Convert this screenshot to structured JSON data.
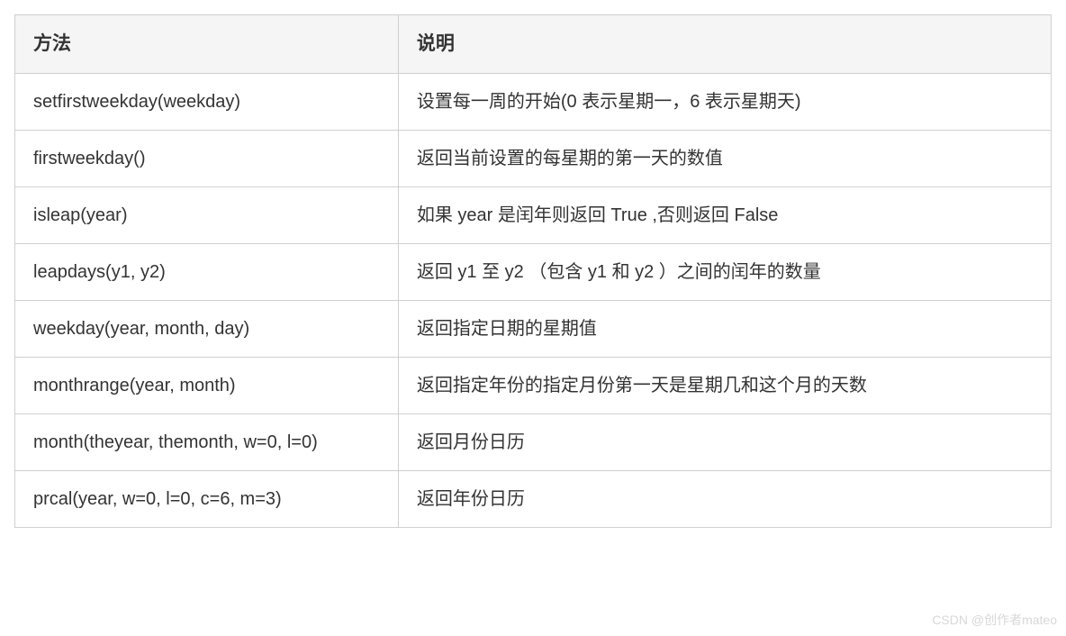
{
  "table": {
    "headers": {
      "method": "方法",
      "description": "说明"
    },
    "rows": [
      {
        "method": "setfirstweekday(weekday)",
        "description": "设置每一周的开始(0 表示星期一，6 表示星期天)"
      },
      {
        "method": "firstweekday()",
        "description": "返回当前设置的每星期的第一天的数值"
      },
      {
        "method": "isleap(year)",
        "description": "如果 year 是闰年则返回 True ,否则返回 False"
      },
      {
        "method": "leapdays(y1, y2)",
        "description": "返回 y1 至 y2 （包含 y1 和 y2 ）之间的闰年的数量"
      },
      {
        "method": "weekday(year, month, day)",
        "description": "返回指定日期的星期值"
      },
      {
        "method": "monthrange(year, month)",
        "description": "返回指定年份的指定月份第一天是星期几和这个月的天数"
      },
      {
        "method": "month(theyear, themonth, w=0, l=0)",
        "description": "返回月份日历"
      },
      {
        "method": "prcal(year, w=0, l=0, c=6, m=3)",
        "description": "返回年份日历"
      }
    ]
  },
  "watermark": "CSDN @创作者mateo"
}
